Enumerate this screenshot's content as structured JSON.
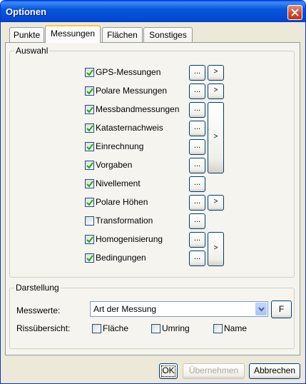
{
  "window": {
    "title": "Optionen"
  },
  "tabs": [
    {
      "label": "Punkte",
      "active": false
    },
    {
      "label": "Messungen",
      "active": true
    },
    {
      "label": "Flächen",
      "active": false
    },
    {
      "label": "Sonstiges",
      "active": false
    }
  ],
  "auswahl": {
    "label": "Auswahl",
    "items": [
      {
        "label": "GPS-Messungen",
        "checked": true
      },
      {
        "label": "Polare Messungen",
        "checked": true
      },
      {
        "label": "Messbandmessungen",
        "checked": true
      },
      {
        "label": "Katasternachweis",
        "checked": true
      },
      {
        "label": "Einrechnung",
        "checked": true
      },
      {
        "label": "Vorgaben",
        "checked": true
      },
      {
        "label": "Nivellement",
        "checked": true
      },
      {
        "label": "Polare Höhen",
        "checked": true
      },
      {
        "label": "Transformation",
        "checked": false
      },
      {
        "label": "Homogenisierung",
        "checked": true
      },
      {
        "label": "Bedingungen",
        "checked": true
      }
    ],
    "dots_label": "...",
    "arrow_label": ">"
  },
  "darstellung": {
    "label": "Darstellung",
    "messwerte_label": "Messwerte:",
    "messwerte_value": "Art der Messung",
    "f_button": "F",
    "rissuebersicht_label": "Rissübersicht:",
    "options": [
      {
        "label": "Fläche",
        "checked": false
      },
      {
        "label": "Umring",
        "checked": false
      },
      {
        "label": "Name",
        "checked": false
      }
    ]
  },
  "footer": {
    "ok": "OK",
    "apply": "Übernehmen",
    "cancel": "Abbrechen"
  }
}
